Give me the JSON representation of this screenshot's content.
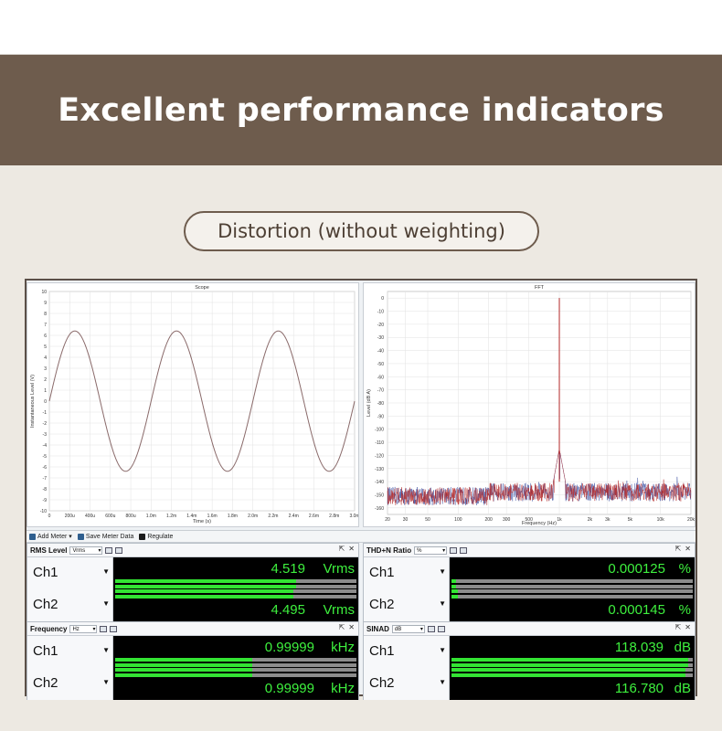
{
  "banner": {
    "title": "Excellent performance indicators"
  },
  "section": {
    "label": "Distortion (without weighting)"
  },
  "scope": {
    "title": "Scope",
    "xlabel": "Time (s)",
    "ylabel": "Instantaneous Level (V)",
    "x_ticks": [
      "0",
      "200u",
      "400u",
      "600u",
      "800u",
      "1.0m",
      "1.2m",
      "1.4m",
      "1.6m",
      "1.8m",
      "2.0m",
      "2.2m",
      "2.4m",
      "2.6m",
      "2.8m",
      "3.0m"
    ],
    "y_ticks": [
      "10",
      "9",
      "8",
      "7",
      "6",
      "5",
      "4",
      "3",
      "2",
      "1",
      "0",
      "-1",
      "-2",
      "-3",
      "-4",
      "-5",
      "-6",
      "-7",
      "-8",
      "-9",
      "-10"
    ]
  },
  "fft": {
    "title": "FFT",
    "xlabel": "Frequency (Hz)",
    "ylabel": "Level (dB A)",
    "x_ticks": [
      "20",
      "30",
      "50",
      "100",
      "200",
      "300",
      "500",
      "1k",
      "2k",
      "3k",
      "5k",
      "10k",
      "20k"
    ],
    "y_ticks": [
      "0",
      "-10",
      "-20",
      "-30",
      "-40",
      "-50",
      "-60",
      "-70",
      "-80",
      "-90",
      "-100",
      "-110",
      "-120",
      "-130",
      "-140",
      "-150",
      "-160"
    ]
  },
  "chart_data": [
    {
      "type": "line",
      "title": "Scope",
      "xlabel": "Time (s)",
      "ylabel": "Instantaneous Level (V)",
      "xlim": [
        0,
        0.003
      ],
      "ylim": [
        -10,
        10
      ],
      "series": [
        {
          "frequency_hz": 1000,
          "amplitude_v": 6.4,
          "color": "#8a6a6a"
        }
      ]
    },
    {
      "type": "line",
      "title": "FFT",
      "xlabel": "Frequency (Hz)",
      "ylabel": "Level (dB A)",
      "xlim": [
        20,
        20000
      ],
      "x_scale": "log",
      "ylim": [
        -165,
        5
      ],
      "series": [
        {
          "peak_hz": 1000,
          "peak_db": 0,
          "noise_floor_db": -158,
          "color": "#b42828"
        },
        {
          "peak_hz": 1000,
          "peak_db": 0,
          "noise_floor_db": -158,
          "color": "#3c4fa0"
        }
      ]
    }
  ],
  "toolbar": {
    "add_meter": "Add Meter",
    "save_meter": "Save Meter Data",
    "regulate": "Regulate"
  },
  "meters": {
    "rms": {
      "title": "RMS Level",
      "select": "Vrms",
      "ch1_label": "Ch1",
      "ch2_label": "Ch2",
      "ch1_value": "4.519",
      "ch2_value": "4.495",
      "unit": "Vrms",
      "ch1_level": 0.75,
      "ch2_level": 0.74
    },
    "thd": {
      "title": "THD+N Ratio",
      "select": "%",
      "ch1_label": "Ch1",
      "ch2_label": "Ch2",
      "ch1_value": "0.000125",
      "ch2_value": "0.000145",
      "unit": "%",
      "ch1_level": 0.02,
      "ch2_level": 0.025
    },
    "freq": {
      "title": "Frequency",
      "select": "Hz",
      "ch1_label": "Ch1",
      "ch2_label": "Ch2",
      "ch1_value": "0.99999",
      "ch2_value": "0.99999",
      "unit": "kHz",
      "ch1_level": 0.57,
      "ch2_level": 0.57
    },
    "sinad": {
      "title": "SINAD",
      "select": "dB",
      "ch1_label": "Ch1",
      "ch2_label": "Ch2",
      "ch1_value": "118.039",
      "ch2_value": "116.780",
      "unit": "dB",
      "ch1_level": 0.98,
      "ch2_level": 0.97
    }
  },
  "colors": {
    "banner": "#6e5c4d",
    "meter_green": "#3ef03e",
    "display_bg": "#000000"
  }
}
